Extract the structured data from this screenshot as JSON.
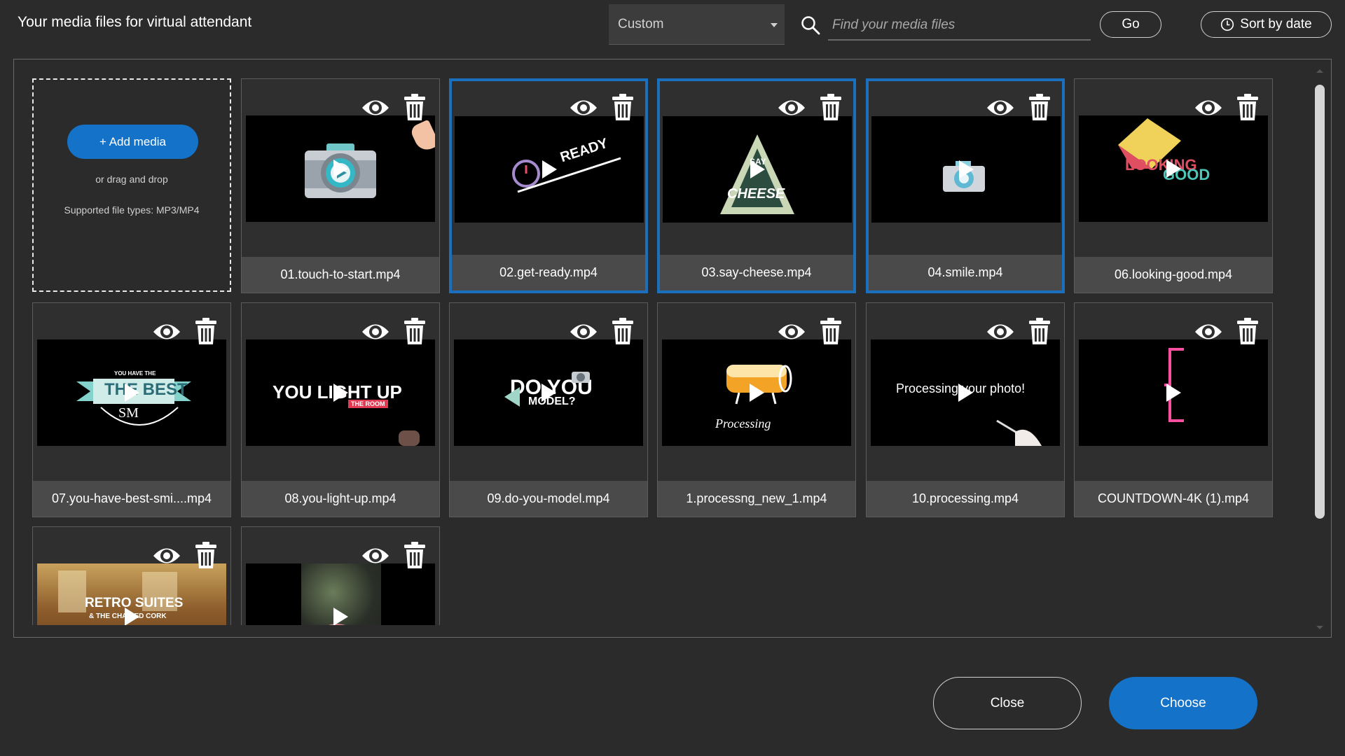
{
  "header": {
    "title": "Your media files for virtual attendant",
    "filter": {
      "selected": "Custom"
    },
    "search": {
      "placeholder": "Find your media files",
      "value": ""
    },
    "go_label": "Go",
    "sort_label": "Sort by date"
  },
  "add_tile": {
    "button_label": "+ Add media",
    "drag_text": "or drag and drop",
    "types_text": "Supported file types: MP3/MP4"
  },
  "media": [
    {
      "name": "01.touch-to-start.mp4",
      "selected": false,
      "thumb": "touch"
    },
    {
      "name": "02.get-ready.mp4",
      "selected": true,
      "thumb": "ready"
    },
    {
      "name": "03.say-cheese.mp4",
      "selected": true,
      "thumb": "cheese"
    },
    {
      "name": "04.smile.mp4",
      "selected": true,
      "thumb": "smile"
    },
    {
      "name": "06.looking-good.mp4",
      "selected": false,
      "thumb": "looking"
    },
    {
      "name": "07.you-have-best-smi....mp4",
      "selected": false,
      "thumb": "best"
    },
    {
      "name": "08.you-light-up.mp4",
      "selected": false,
      "thumb": "lightup"
    },
    {
      "name": "09.do-you-model.mp4",
      "selected": false,
      "thumb": "model"
    },
    {
      "name": "1.processng_new_1.mp4",
      "selected": false,
      "thumb": "processing1"
    },
    {
      "name": "10.processing.mp4",
      "selected": false,
      "thumb": "processing10"
    },
    {
      "name": "COUNTDOWN-4K (1).mp4",
      "selected": false,
      "thumb": "countdown"
    },
    {
      "name": "",
      "selected": false,
      "thumb": "retro"
    },
    {
      "name": "",
      "selected": false,
      "thumb": "floral"
    }
  ],
  "thumb_text": {
    "ready": "READY",
    "cheese_top": "SAY",
    "cheese": "CHEESE",
    "looking": "LOOKING",
    "looking2": "GOOD",
    "best_top": "YOU HAVE THE",
    "best": "THE BEST",
    "best_sm": "SM",
    "lightup": "YOU LIGHT UP",
    "lightup_sub": "THE ROOM",
    "model": "DO YOU",
    "model_sub": "MODEL?",
    "processing_script": "Processing",
    "processing10": "Processing your photo!",
    "retro": "RETRO SUITES",
    "retro_sub": "& THE CHAINED CORK"
  },
  "footer": {
    "close_label": "Close",
    "choose_label": "Choose"
  },
  "colors": {
    "accent": "#1473c9",
    "selected_border": "#1a6fbf",
    "background": "#2b2b2b"
  }
}
